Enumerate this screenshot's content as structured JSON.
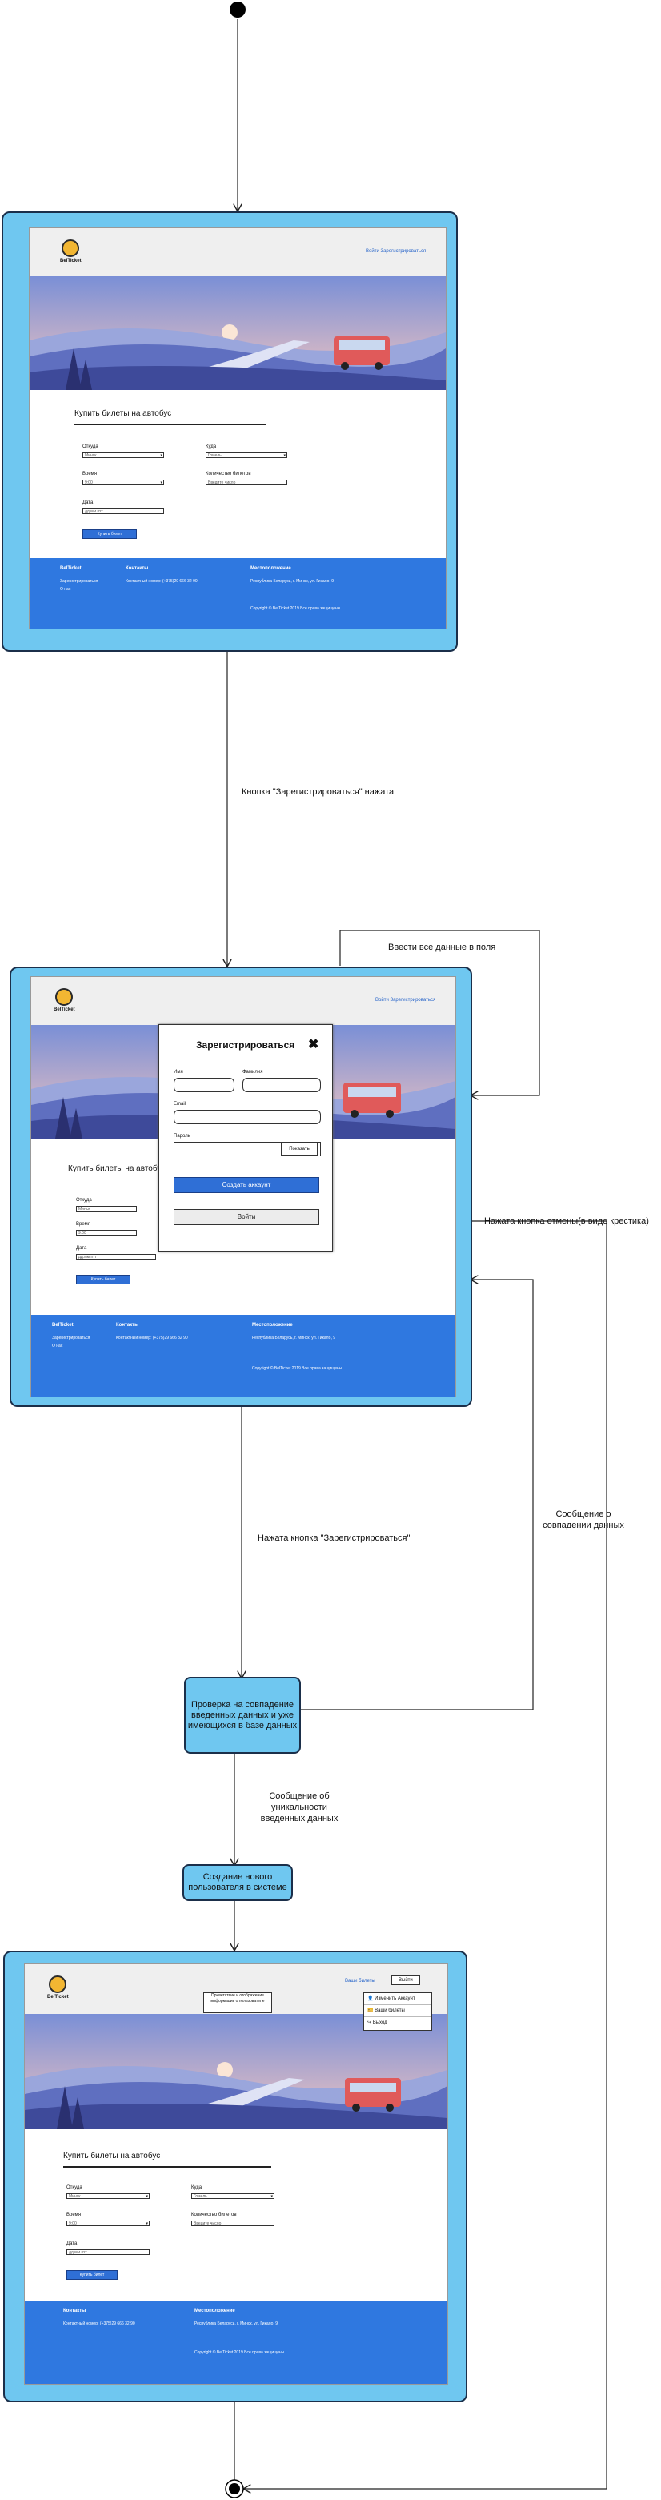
{
  "colors": {
    "node_fill": "#6fc7f0",
    "node_border": "#1b2f4a",
    "footer_blue": "#2f78e0",
    "button_blue": "#2f6fd6",
    "link_blue": "#2563c9"
  },
  "site": {
    "logo_text": "BelTicket",
    "header_login": "Войти",
    "header_register": "Зарегистрироваться",
    "header_my_tickets": "Ваши билеты",
    "header_exit": "Выйти",
    "form_title": "Купить билеты на автобус",
    "from_label": "Откуда",
    "from_value": "Минск",
    "to_label": "Куда",
    "to_value": "Гомель",
    "time_label": "Время",
    "time_value": "9:00",
    "count_label": "Количество билетов",
    "count_value": "Введите число",
    "date_label": "Дата",
    "date_value": "дд.мм.гггг",
    "buy_button": "Купить билет",
    "footer": {
      "brand": "BelTicket",
      "register": "Зарегистрироваться",
      "about": "О нас",
      "contacts_title": "Контакты",
      "phone": "Контактный номер: (+375)29 666 32 90",
      "location_title": "Местоположение",
      "address": "Республика Беларусь, г. Минск, ул. Гикало, 9",
      "copyright": "Copyright © BelTicket 2019 Все права защищены"
    }
  },
  "modal": {
    "title": "Зарегистрироваться",
    "close": "✖",
    "name_label": "Имя",
    "surname_label": "Фамилия",
    "email_label": "Email",
    "password_label": "Пароль",
    "show_button": "Показать",
    "create_button": "Создать аккаунт",
    "login_button": "Войти"
  },
  "menu": {
    "items": [
      "Изменить Аккаунт",
      "Ваши билеты",
      "Выход"
    ],
    "callout": "Приветствие и отображение информации о пользователе"
  },
  "transitions": {
    "register_clicked": "Кнопка \"Зарегистрироваться\" нажата",
    "fill_all": "Ввести все данные в поля",
    "cancel_clicked": "Нажата кнопка отмены(в виде крестика)",
    "register_pressed": "Нажата кнопка \"Зарегистрироваться\"",
    "match_message": "Сообщение о совпадении данных",
    "unique_message": "Сообщение об уникальности введенных данных"
  },
  "processes": {
    "check": "Проверка на совпадение введенных данных и уже имеющихся в базе данных",
    "create_user": "Создание нового пользователя в системе"
  }
}
